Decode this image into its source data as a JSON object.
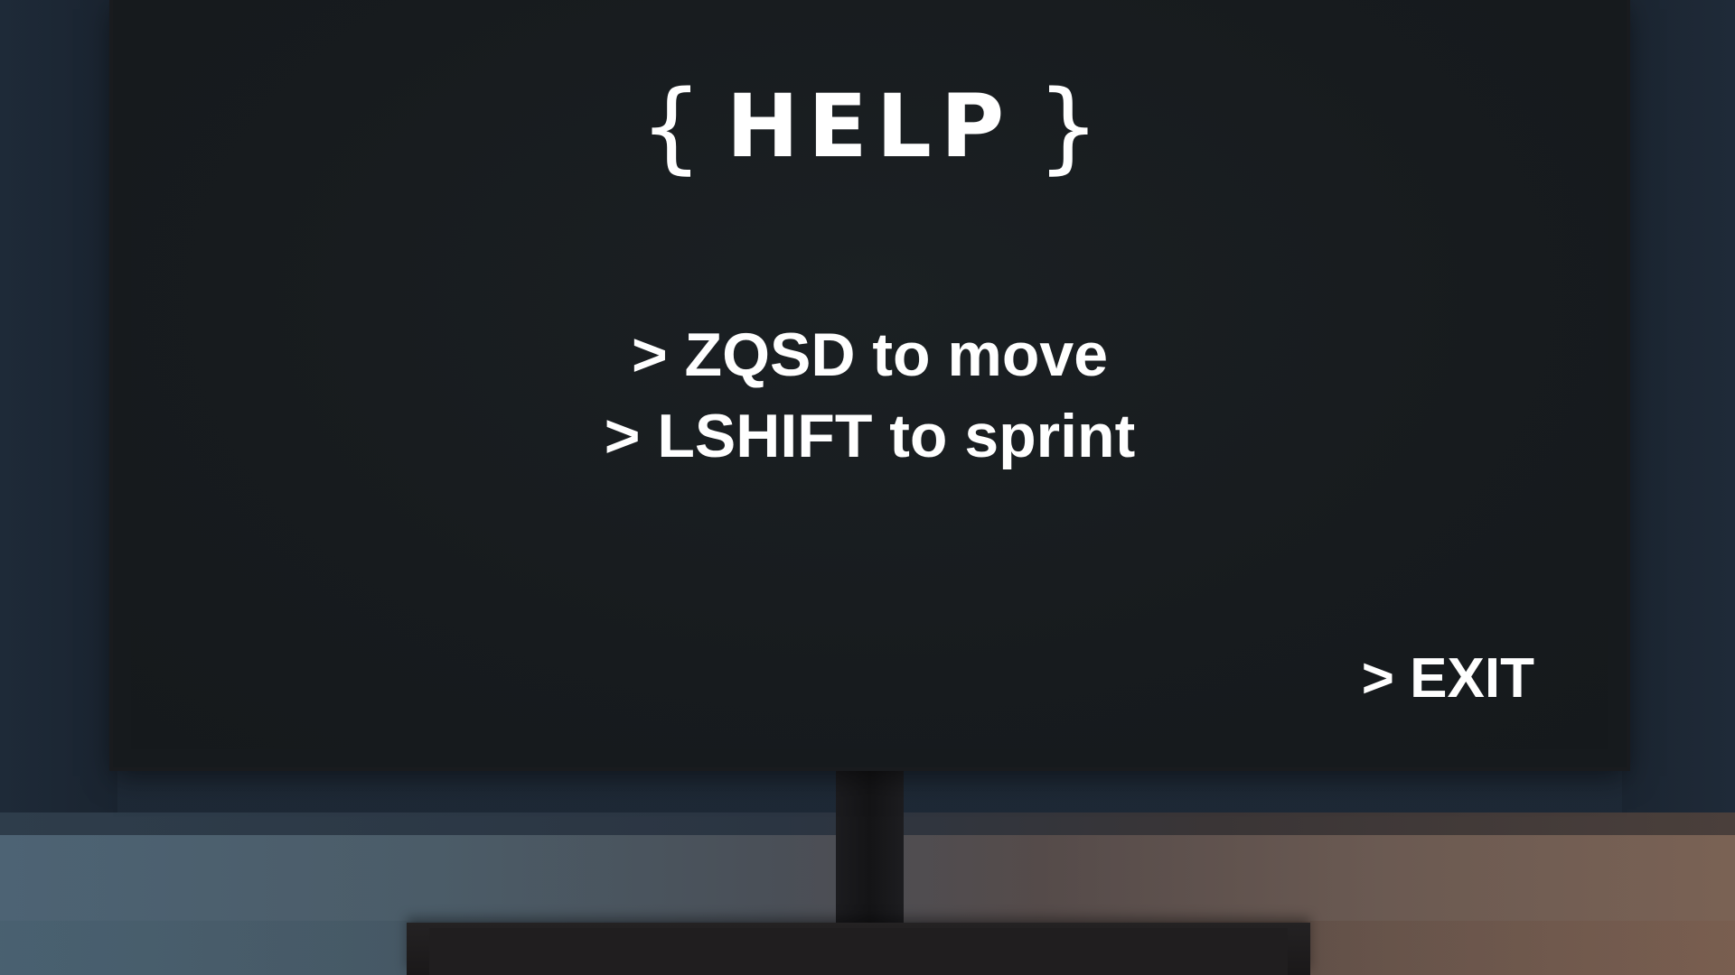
{
  "help_screen": {
    "title": {
      "brace_open": "{",
      "text": "HELP",
      "brace_close": "}"
    },
    "instructions": [
      "> ZQSD to move",
      "> LSHIFT to sprint"
    ],
    "exit_label": "> EXIT"
  },
  "colors": {
    "text": "#ffffff",
    "screen": "#171b1e",
    "room": "#1b2633"
  }
}
